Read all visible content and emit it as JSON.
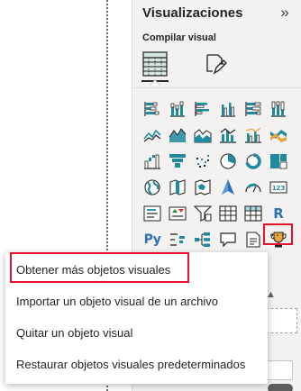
{
  "panel": {
    "title": "Visualizaciones",
    "collapse_icon": "chevron-double-right",
    "build_label": "Compilar visual",
    "tabs": [
      {
        "name": "build-visual-tab",
        "icon": "table-grid-icon",
        "selected": true
      },
      {
        "name": "format-visual-tab",
        "icon": "paintbrush-icon",
        "selected": false
      }
    ]
  },
  "visuals": {
    "rows": [
      [
        "stacked-bar-chart",
        "stacked-column-chart",
        "clustered-bar-chart",
        "clustered-column-chart",
        "100-stacked-bar-chart",
        "100-stacked-column-chart"
      ],
      [
        "line-chart",
        "area-chart",
        "stacked-area-chart",
        "line-and-column-chart",
        "line-and-clustered-column-chart",
        "ribbon-chart"
      ],
      [
        "waterfall-chart",
        "funnel-chart",
        "scatter-chart",
        "pie-chart",
        "donut-chart",
        "treemap"
      ],
      [
        "map",
        "filled-map",
        "shape-map",
        "azure-map",
        "gauge",
        "card"
      ],
      [
        "multi-row-card",
        "kpi",
        "slicer",
        "table",
        "matrix",
        "r-script-visual"
      ],
      [
        "python-visual",
        "key-influencers",
        "decomposition-tree",
        "qa",
        "smart-narrative",
        "goals"
      ]
    ],
    "python_text": "Py",
    "r_text": "R",
    "card_text": "123",
    "more_label": "···"
  },
  "menu": {
    "items": [
      {
        "label": "Obtener más objetos visuales"
      },
      {
        "label": "Importar un objeto visual de un archivo"
      },
      {
        "label": "Quitar un objeto visual"
      },
      {
        "label": "Restaurar objetos visuales predeterminados"
      }
    ]
  },
  "colors": {
    "accent_blue": "#2f6fb3",
    "accent_teal": "#1f8a9e",
    "accent_orange": "#e8a33c",
    "highlight_red": "#e5122e",
    "panel_bg": "#f3f2f1"
  }
}
